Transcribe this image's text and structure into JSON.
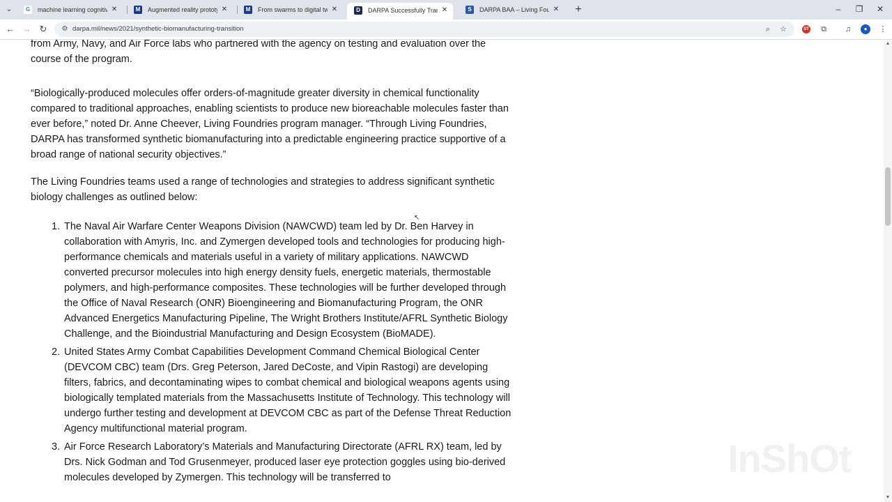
{
  "browser": {
    "tabs": [
      {
        "title": "machine learning cognitive elec",
        "favicon": "G",
        "favicon_color": "#4285f4",
        "active": false
      },
      {
        "title": "Augmented reality prototypes",
        "favicon": "M",
        "favicon_color": "#1a3a8a",
        "active": false
      },
      {
        "title": "From swarms to digital twins: A",
        "favicon": "M",
        "favicon_color": "#1a3a8a",
        "active": false
      },
      {
        "title": "DARPA Successfully Transitions",
        "favicon": "D",
        "favicon_color": "#1a2a55",
        "active": true
      },
      {
        "title": "DARPA BAA – Living Foundries",
        "favicon": "S",
        "favicon_color": "#2a5aa0",
        "active": false
      }
    ],
    "new_tab": "+",
    "window_controls": {
      "minimize": "–",
      "restore": "❐",
      "close": "✕"
    },
    "url": "darpa.mil/news/2021/synthetic-biomanufacturing-transition"
  },
  "article": {
    "p0": "from Army, Navy, and Air Force labs who partnered with the agency on testing and evaluation over the course of the program.",
    "p1": "“Biologically-produced molecules offer orders-of-magnitude greater diversity in chemical functionality compared to traditional approaches, enabling scientists to produce new bioreachable molecules faster than ever before,” noted Dr. Anne Cheever, Living Foundries program manager. “Through Living Foundries, DARPA has transformed synthetic biomanufacturing into a predictable engineering practice supportive of a broad range of national security objectives.”",
    "p2": "The Living Foundries teams used a range of technologies and strategies to address significant synthetic biology challenges as outlined below:",
    "items": [
      {
        "num": "1.",
        "text": "The Naval Air Warfare Center Weapons Division (NAWCWD) team led by Dr. Ben Harvey in collaboration with Amyris, Inc. and Zymergen developed tools and technologies for producing high-performance chemicals and materials useful in a variety of military applications. NAWCWD converted precursor molecules into high energy density fuels, energetic materials, thermostable polymers, and high-performance composites. These technologies will be further developed through the Office of Naval Research (ONR) Bioengineering and Biomanufacturing Program, the ONR Advanced Energetics Manufacturing Pipeline, The Wright Brothers Institute/AFRL Synthetic Biology Challenge, and the Bioindustrial Manufacturing and Design Ecosystem (BioMADE)."
      },
      {
        "num": "2.",
        "text": "United States Army Combat Capabilities Development Command Chemical Biological Center (DEVCOM CBC) team (Drs. Greg Peterson, Jared DeCoste, and Vipin Rastogi) are developing filters, fabrics, and decontaminating wipes to combat chemical and biological weapons agents using biologically templated materials from the Massachusetts Institute of Technology. This technology will undergo further testing and development at DEVCOM CBC as part of the Defense Threat Reduction Agency multifunctional material program."
      },
      {
        "num": "3.",
        "text": "Air Force Research Laboratory’s Materials and Manufacturing Directorate (AFRL RX) team, led by Drs. Nick Godman and Tod Grusenmeyer, produced laser eye protection goggles using bio-derived molecules developed by Zymergen. This technology will be transferred to"
      }
    ]
  },
  "watermark": "InShOt"
}
